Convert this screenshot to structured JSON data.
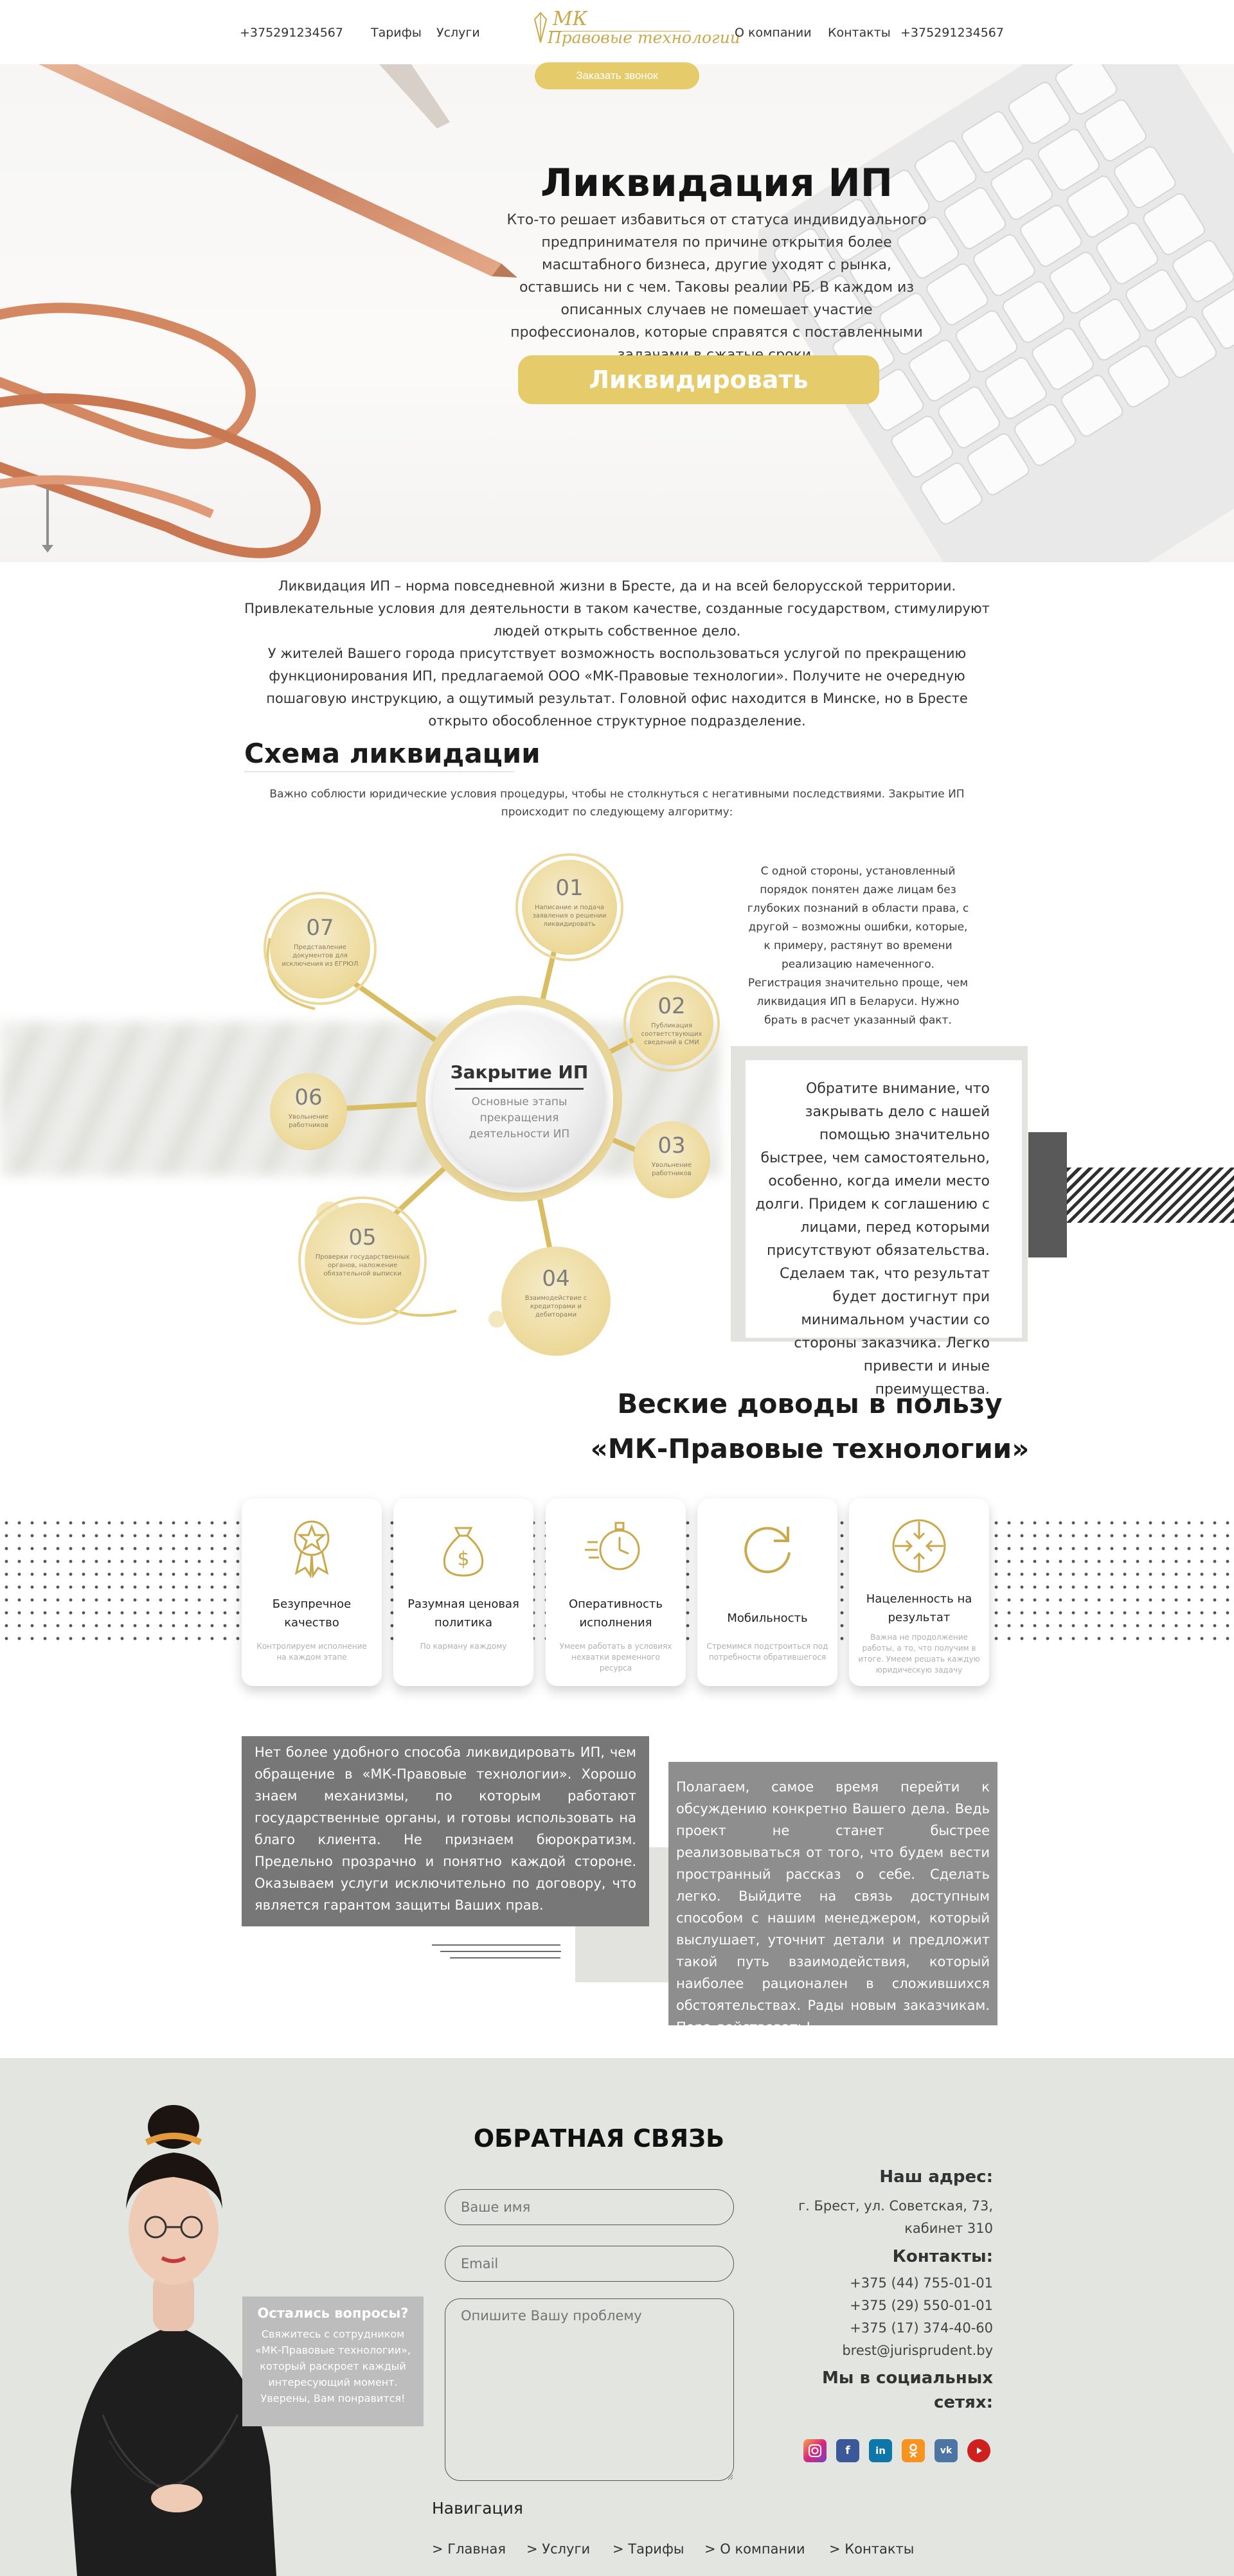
{
  "header": {
    "phone_left": "+375291234567",
    "nav_tariffs": "Тарифы",
    "nav_services": "Услуги",
    "logo_mark": "МК",
    "logo_text": "Правовые технологии",
    "nav_about": "О компании",
    "nav_contacts": "Контакты",
    "phone_right": "+375291234567",
    "call_button": "Заказать звонок"
  },
  "hero": {
    "title": "Ликвидация ИП",
    "text": "Кто-то решает избавиться от статуса индивидуального предпринимателя по причине открытия более масштабного бизнеса, другие уходят с рынка, оставшись ни с чем. Таковы реалии РБ. В каждом из описанных случаев не помешает участие профессионалов, которые справятся с поставленными задачами в сжатые сроки.",
    "button": "Ликвидировать"
  },
  "intro": {
    "p1": "Ликвидация ИП – норма повседневной жизни в Бресте, да и на всей белорусской территории. Привлекательные условия для деятельности в таком качестве, созданные государством, стимулируют людей открыть собственное дело.",
    "p2": "У жителей Вашего города присутствует возможность воспользоваться услугой по прекращению функционирования ИП, предлагаемой ООО «МК-Правовые технологии». Получите не очередную пошаговую инструкцию, а ощутимый результат. Головной офис находится в Минске, но в Бресте открыто обособленное структурное подразделение."
  },
  "scheme": {
    "title": "Схема ликвидации",
    "subtitle": "Важно соблюсти юридические условия процедуры, чтобы не столкнуться с негативными последствиями. Закрытие ИП происходит по следующему алгоритму:",
    "center_title": "Закрытие ИП",
    "center_sub": "Основные этапы прекращения деятельности ИП",
    "steps": [
      {
        "num": "01",
        "text": "Написание и подача заявления о решении ликвидировать"
      },
      {
        "num": "02",
        "text": "Публикация соответствующих сведений в СМИ"
      },
      {
        "num": "03",
        "text": "Увольнение работников"
      },
      {
        "num": "04",
        "text": "Взаимодействие с кредиторами и дебиторами"
      },
      {
        "num": "05",
        "text": "Проверки государственных органов, наложение обязательной выписки"
      },
      {
        "num": "06",
        "text": "Увольнение работников"
      },
      {
        "num": "07",
        "text": "Представление документов для исключения из ЕГРЮЛ"
      }
    ],
    "side_text": "С одной стороны, установленный порядок понятен даже лицам без глубоких познаний в области права, с другой – возможны ошибки, которые, к примеру, растянут во времени реализацию намеченного. Регистрация значительно проще, чем ликвидация ИП в Беларуси. Нужно брать в расчет указанный факт.",
    "note": "Обратите внимание, что закрывать дело с нашей помощью значительно быстрее, чем самостоятельно, особенно, когда имели место долги. Придем к соглашению с лицами, перед которыми присутствуют обязательства. Сделаем так, что результат будет достигнут при минимальном участии со стороны заказчика. Легко привести и иные преимущества."
  },
  "advantages": {
    "title_line1": "Веские доводы в пользу",
    "title_line2": "«МК-Правовые технологии»",
    "cards": [
      {
        "icon": "award-icon",
        "label": "Безупречное качество",
        "note": "Контролируем исполнение на каждом этапе"
      },
      {
        "icon": "money-bag-icon",
        "label": "Разумная ценовая политика",
        "note": "По карману каждому"
      },
      {
        "icon": "stopwatch-icon",
        "label": "Оперативность исполнения",
        "note": "Умеем работать в условиях нехватки временного ресурса"
      },
      {
        "icon": "refresh-icon",
        "label": "Мобильность",
        "note": "Стремимся подстроиться под потребности обратившегося"
      },
      {
        "icon": "target-icon",
        "label": "Нацеленность на результат",
        "note": "Важна не продолжение работы, а то, что получим в итоге. Умеем решать каждую юридическую задачу"
      }
    ]
  },
  "blocks": {
    "left": "Нет более удобного способа ликвидировать ИП, чем обращение в «МК-Правовые технологии». Хорошо знаем механизмы, по которым работают государственные органы, и готовы использовать на благо клиента. Не признаем бюрократизм. Предельно прозрачно и понятно каждой стороне. Оказываем услуги исключительно по договору, что является гарантом защиты Ваших прав.",
    "right": "Полагаем, самое время перейти к обсуждению конкретно Вашего дела. Ведь проект не станет быстрее реализовываться от того, что будем вести пространный рассказ о себе. Сделать легко. Выйдите на связь доступным способом с нашим менеджером, который выслушает, уточнит детали и предложит такой путь взаимодействия, который наиболее рационален в сложившихся обстоятельствах. Рады новым заказчикам. Пора действовать!"
  },
  "contact": {
    "tooltip_title": "Остались вопросы?",
    "tooltip_text": "Свяжитесь с сотрудником «МК-Правовые технологии», который раскроет каждый интересующий момент. Уверены, Вам понравится!",
    "form_title": "ОБРАТНАЯ СВЯЗЬ",
    "name_placeholder": "Ваше имя",
    "email_placeholder": "Email",
    "message_placeholder": "Опишите Вашу проблему",
    "address_heading": "Наш адрес:",
    "address_line1": "г. Брест, ул. Советская, 73,",
    "address_line2": "кабинет 310",
    "contacts_heading": "Контакты:",
    "phone1": "+375 (44) 755-01-01",
    "phone2": "+375 (29) 550-01-01",
    "phone3": "+375 (17) 374-40-60",
    "email": "brest@jurisprudent.by",
    "social_heading": "Мы в социальных сетях:",
    "socials": [
      "instagram-icon",
      "facebook-icon",
      "linkedin-icon",
      "odnoklassniki-icon",
      "vk-icon",
      "youtube-icon"
    ]
  },
  "navigation": {
    "title": "Навигация",
    "items": [
      "> Главная",
      "> Услуги",
      "> Тарифы",
      "> О компании",
      "> Контакты"
    ]
  },
  "colors": {
    "gold": "#e6cb6b",
    "gold_light": "#ecd898",
    "grey_box": "#777777",
    "footer_bg": "#e3e5e1"
  }
}
